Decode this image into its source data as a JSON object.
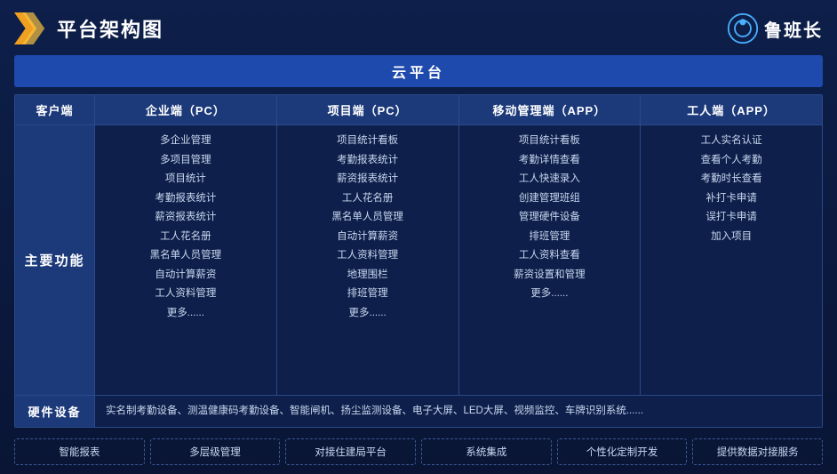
{
  "header": {
    "title": "平台架构图",
    "brand_name": "鲁班长"
  },
  "cloud_platform": "云平台",
  "columns": {
    "client": "客户端",
    "enterprise_pc": "企业端（PC）",
    "project_pc": "项目端（PC）",
    "mobile_app": "移动管理端（APP）",
    "worker_app": "工人端（APP）"
  },
  "row_label_main": "主要功能",
  "features": {
    "enterprise": [
      "多企业管理",
      "多项目管理",
      "项目统计",
      "考勤报表统计",
      "薪资报表统计",
      "工人花名册",
      "黑名单人员管理",
      "自动计算薪资",
      "工人资料管理",
      "更多......"
    ],
    "project": [
      "项目统计看板",
      "考勤报表统计",
      "薪资报表统计",
      "工人花名册",
      "黑名单人员管理",
      "自动计算薪资",
      "工人资料管理",
      "地理围栏",
      "排班管理",
      "更多......"
    ],
    "mobile": [
      "项目统计看板",
      "考勤详情查看",
      "工人快速录入",
      "创建管理班组",
      "管理硬件设备",
      "排班管理",
      "工人资料查看",
      "薪资设置和管理",
      "更多......"
    ],
    "worker": [
      "工人实名认证",
      "查看个人考勤",
      "考勤时长查看",
      "补打卡申请",
      "误打卡申请",
      "加入项目"
    ]
  },
  "hardware": {
    "label": "硬件设备",
    "content": "实名制考勤设备、测温健康码考勤设备、智能闸机、扬尘监测设备、电子大屏、LED大屏、视频监控、车牌识别系统......"
  },
  "services": [
    "智能报表",
    "多层级管理",
    "对接住建局平台",
    "系统集成",
    "个性化定制开发",
    "提供数据对接服务"
  ]
}
